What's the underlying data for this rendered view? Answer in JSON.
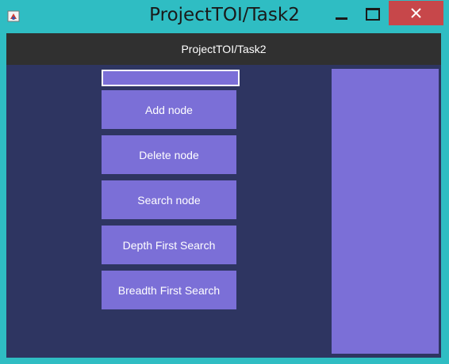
{
  "window": {
    "title": "ProjectTOI/Task2",
    "icons": {
      "app": "java-app-icon",
      "minimize": "minimize-icon",
      "maximize": "maximize-icon",
      "close": "close-icon"
    }
  },
  "header": {
    "title": "ProjectTOI/Task2"
  },
  "input": {
    "value": ""
  },
  "buttons": [
    {
      "label": "Add node"
    },
    {
      "label": "Delete node"
    },
    {
      "label": "Search node"
    },
    {
      "label": "Depth First Search"
    },
    {
      "label": "Breadth First Search"
    }
  ],
  "colors": {
    "window_frame": "#2fbdc3",
    "header": "#303030",
    "background": "#2e3561",
    "accent": "#7b6fd7",
    "close": "#c7474a"
  }
}
